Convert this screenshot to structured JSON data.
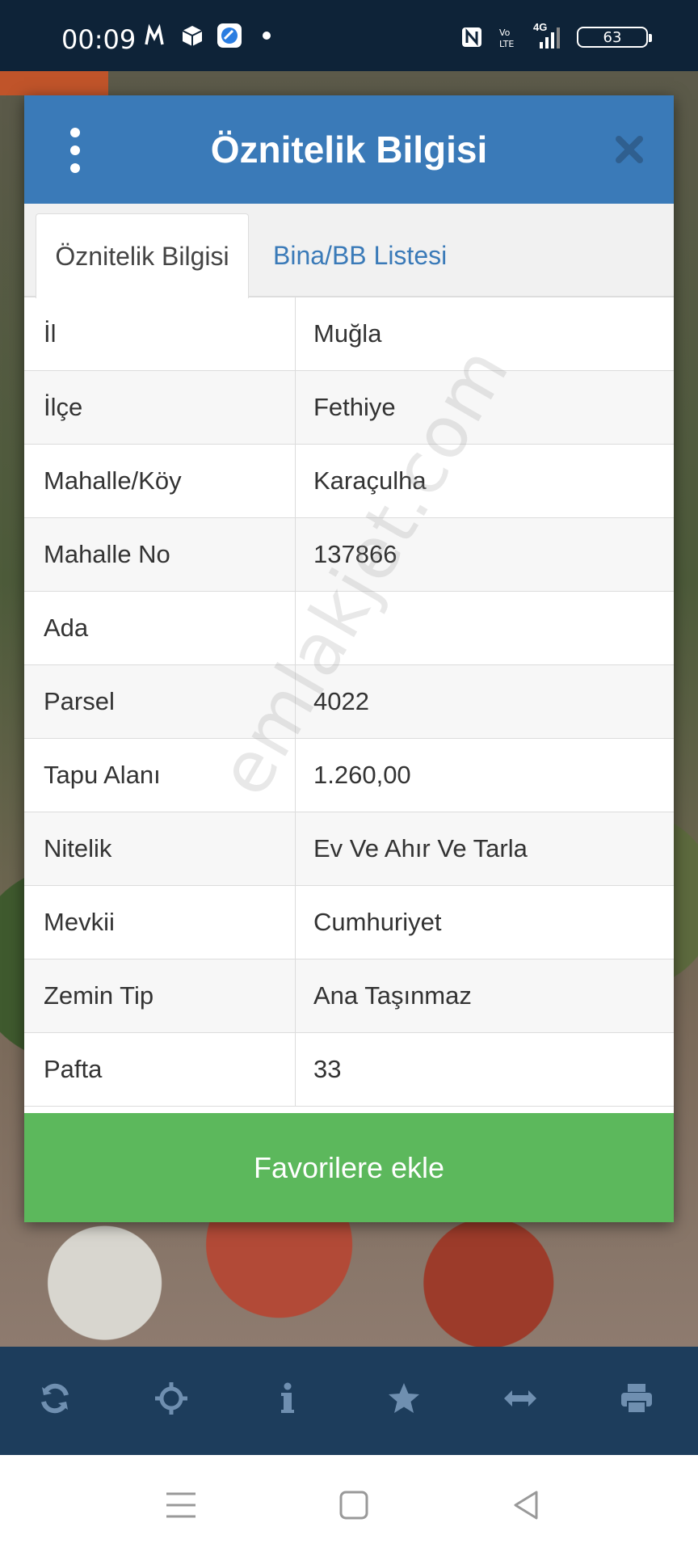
{
  "status_bar": {
    "time": "00:09",
    "battery": "63",
    "network_label": "4G",
    "icons": [
      "music-icon",
      "box-icon",
      "app-icon",
      "dot-icon",
      "nfc-icon",
      "volte-icon",
      "signal-icon",
      "battery-icon"
    ]
  },
  "dialog": {
    "title": "Öznitelik Bilgisi",
    "tabs": [
      {
        "label": "Öznitelik Bilgisi",
        "active": true
      },
      {
        "label": "Bina/BB Listesi",
        "active": false
      }
    ],
    "rows": [
      {
        "key": "İl",
        "value": "Muğla"
      },
      {
        "key": "İlçe",
        "value": "Fethiye"
      },
      {
        "key": "Mahalle/Köy",
        "value": "Karaçulha"
      },
      {
        "key": "Mahalle No",
        "value": "137866"
      },
      {
        "key": "Ada",
        "value": ""
      },
      {
        "key": "Parsel",
        "value": "4022"
      },
      {
        "key": "Tapu Alanı",
        "value": "1.260,00"
      },
      {
        "key": "Nitelik",
        "value": "Ev Ve Ahır Ve Tarla"
      },
      {
        "key": "Mevkii",
        "value": "Cumhuriyet"
      },
      {
        "key": "Zemin Tip",
        "value": "Ana Taşınmaz"
      },
      {
        "key": "Pafta",
        "value": "33"
      }
    ],
    "favorite_button": "Favorilere ekle"
  },
  "watermark": "emlakjet.com",
  "colors": {
    "header": "#3a7ab8",
    "tab_link": "#3a7ab8",
    "favorite_button": "#5cb85c",
    "toolbar": "#1d3d5c"
  },
  "toolbar": {
    "icons": [
      "refresh-icon",
      "crosshair-icon",
      "info-icon",
      "star-icon",
      "measure-icon",
      "print-icon"
    ]
  }
}
